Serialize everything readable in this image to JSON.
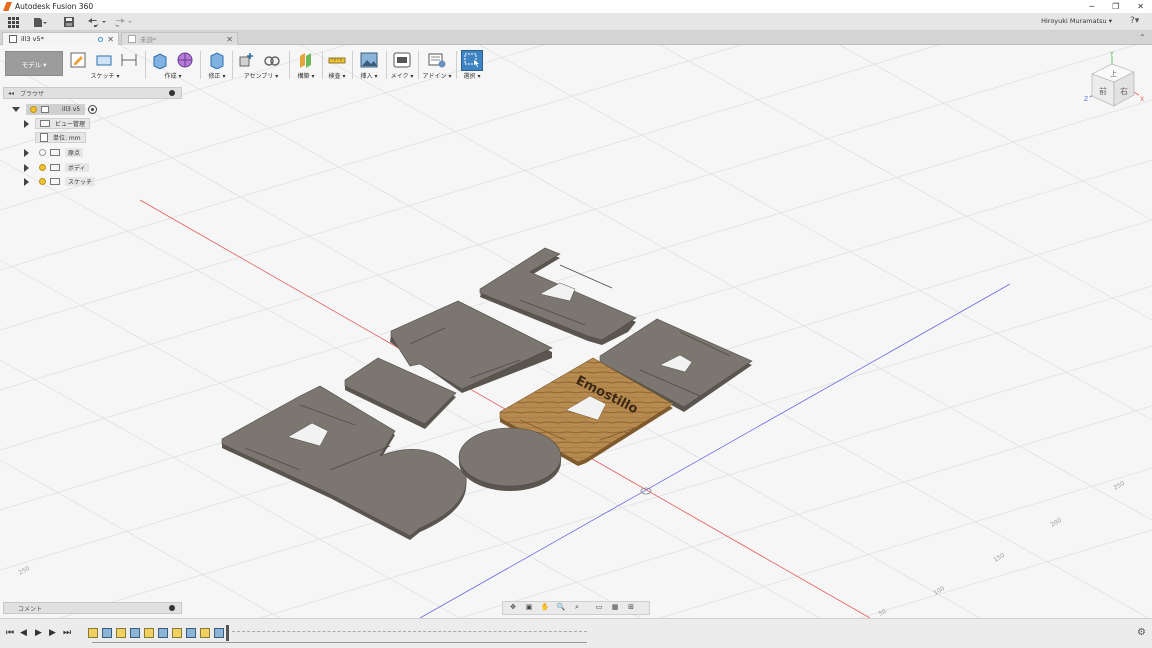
{
  "titlebar": {
    "title": "Autodesk Fusion 360",
    "minimize": "─",
    "restore": "❐",
    "close": "✕"
  },
  "qat": {
    "user": "Hiroyuki Muramatsu ▾",
    "help": "?▾"
  },
  "tabs": [
    {
      "label": "ill3 v5*",
      "close": "✕"
    },
    {
      "label": "未読*",
      "close": "✕"
    }
  ],
  "toolbar": {
    "workspace": "モデル ▾",
    "groups": [
      {
        "label": "スケッチ ▾"
      },
      {
        "label": "作成 ▾"
      },
      {
        "label": "修正 ▾"
      },
      {
        "label": "アセンブリ ▾"
      },
      {
        "label": "構築 ▾"
      },
      {
        "label": "検査 ▾"
      },
      {
        "label": "挿入 ▾"
      },
      {
        "label": "メイク ▾"
      },
      {
        "label": "アドイン ▾"
      },
      {
        "label": "選択 ▾"
      }
    ]
  },
  "browser": {
    "header": "ブラウザ",
    "root": "ill3 v5",
    "items": [
      {
        "label": "ビュー管理"
      },
      {
        "label": "単位: mm"
      },
      {
        "label": "原点"
      },
      {
        "label": "ボディ"
      },
      {
        "label": "スケッチ"
      }
    ]
  },
  "comments": {
    "label": "コメント"
  },
  "viewcube": {
    "top": "上",
    "front": "前",
    "right": "右",
    "axis_x": "X",
    "axis_y": "Y",
    "axis_z": "Z"
  },
  "grid_labels": [
    "250",
    "200",
    "150",
    "100",
    "50",
    "250"
  ],
  "engraving": "Emostillo",
  "colors": {
    "body": "#7b766f",
    "wood": "#b88a4f",
    "grid": "#dcdcdc",
    "x_axis": "#e35a5a",
    "z_axis": "#6a6ae0"
  }
}
